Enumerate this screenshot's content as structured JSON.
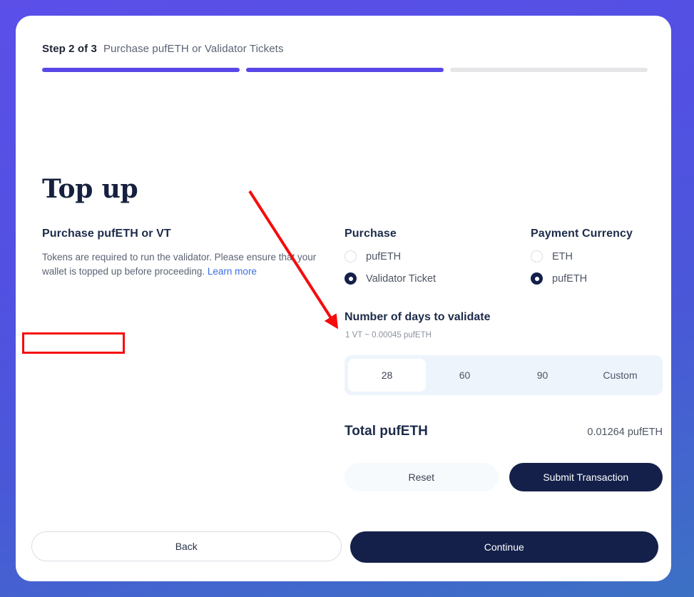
{
  "stepper": {
    "step_count": "Step 2 of 3",
    "step_title": "Purchase pufETH or Validator Tickets",
    "segments": [
      {
        "state": "filled"
      },
      {
        "state": "filled"
      },
      {
        "state": "empty"
      }
    ]
  },
  "page": {
    "title": "Top up"
  },
  "info": {
    "heading": "Purchase pufETH or VT",
    "description": "Tokens are required to run the validator. Please ensure that your wallet is topped up before proceeding. ",
    "link_label": "Learn more"
  },
  "purchase": {
    "heading": "Purchase",
    "options": [
      {
        "label": "pufETH",
        "selected": false
      },
      {
        "label": "Validator Ticket",
        "selected": true
      }
    ]
  },
  "payment_currency": {
    "heading": "Payment Currency",
    "options": [
      {
        "label": "ETH",
        "selected": false
      },
      {
        "label": "pufETH",
        "selected": true
      }
    ]
  },
  "days": {
    "heading": "Number of days to validate",
    "rate_note": "1 VT ~ 0.00045 pufETH",
    "tabs": [
      {
        "label": "28",
        "active": true
      },
      {
        "label": "60",
        "active": false
      },
      {
        "label": "90",
        "active": false
      },
      {
        "label": "Custom",
        "active": false
      }
    ]
  },
  "total": {
    "label": "Total pufETH",
    "value": "0.01264 pufETH"
  },
  "actions": {
    "reset_label": "Reset",
    "submit_label": "Submit Transaction"
  },
  "footer": {
    "back_label": "Back",
    "continue_label": "Continue"
  },
  "colors": {
    "accent_purple": "#5948e8",
    "navy": "#14204a",
    "link_blue": "#3a6fe0",
    "tab_track": "#eef4fc",
    "annotation_red": "#f50c0c"
  }
}
